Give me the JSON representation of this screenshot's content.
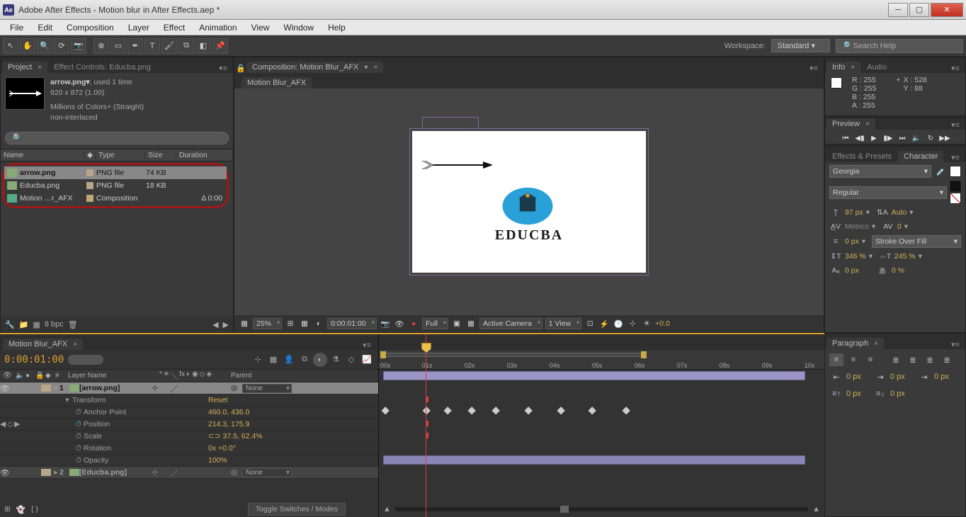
{
  "titlebar": {
    "icon_label": "Ae",
    "title": "Adobe After Effects - Motion blur in After Effects.aep *"
  },
  "menubar": [
    "File",
    "Edit",
    "Composition",
    "Layer",
    "Effect",
    "Animation",
    "View",
    "Window",
    "Help"
  ],
  "toolbar": {
    "workspace_label": "Workspace:",
    "workspace_value": "Standard",
    "search_placeholder": "Search Help"
  },
  "project": {
    "tab_project": "Project",
    "tab_effect_controls": "Effect Controls: Educba.png",
    "asset": {
      "name": "arrow.png▾",
      "usage": ", used 1 time",
      "dims": "920 x 872 (1.00)",
      "colors": "Millions of Colors+ (Straight)",
      "interlace": "non-interlaced"
    },
    "cols": {
      "name": "Name",
      "type": "Type",
      "size": "Size",
      "duration": "Duration"
    },
    "rows": [
      {
        "name": "arrow.png",
        "type": "PNG file",
        "size": "74 KB",
        "duration": ""
      },
      {
        "name": "Educba.png",
        "type": "PNG file",
        "size": "18 KB",
        "duration": ""
      },
      {
        "name": "Motion …r_AFX",
        "type": "Composition",
        "size": "",
        "duration": "Δ 0:00"
      }
    ],
    "bpc": "8 bpc"
  },
  "composition": {
    "tab_label": "Composition: Motion Blur_AFX",
    "inner_tab": "Motion Blur_AFX",
    "logo_text": "EDUCBA",
    "footer": {
      "zoom": "25%",
      "time": "0:00:01:00",
      "res": "Full",
      "camera": "Active Camera",
      "views": "1 View",
      "exposure": "+0.0"
    }
  },
  "info": {
    "tab_info": "Info",
    "tab_audio": "Audio",
    "r": "R : 255",
    "g": "G : 255",
    "b": "B : 255",
    "a": "A : 255",
    "x": "X : 528",
    "y": "Y : 88"
  },
  "preview": {
    "tab": "Preview"
  },
  "effects_presets": {
    "tab": "Effects & Presets"
  },
  "character": {
    "tab": "Character",
    "font": "Georgia",
    "style": "Regular",
    "size": "97 px",
    "leading": "Auto",
    "kerning": "Metrics",
    "tracking": "0",
    "stroke_w": "0 px",
    "stroke_mode": "Stroke Over Fill",
    "vscale": "346 %",
    "hscale": "245 %",
    "baseline": "0 px",
    "tsume": "0 %"
  },
  "paragraph": {
    "tab": "Paragraph",
    "indent_l": "0 px",
    "indent_r": "0 px",
    "indent_first": "0 px",
    "space_before": "0 px",
    "space_after": "0 px"
  },
  "timeline": {
    "tab": "Motion Blur_AFX",
    "timecode": "0:00:01:00",
    "cols": {
      "layer": "Layer Name",
      "parent": "Parent"
    },
    "layers": [
      {
        "num": "1",
        "name": "[arrow.png]",
        "parent": "None"
      },
      {
        "num": "2",
        "name": "[Educba.png]",
        "parent": "None"
      }
    ],
    "transform": "Transform",
    "reset": "Reset",
    "props": [
      {
        "name": "Anchor Point",
        "val": "460.0, 436.0",
        "kf": false
      },
      {
        "name": "Position",
        "val": "214.3, 175.9",
        "kf": true
      },
      {
        "name": "Scale",
        "val": "⊂⊃ 37.5, 62.4%",
        "kf": false
      },
      {
        "name": "Rotation",
        "val": "0x +0.0°",
        "kf": false
      },
      {
        "name": "Opacity",
        "val": "100%",
        "kf": false
      }
    ],
    "toggle_label": "Toggle Switches / Modes",
    "ticks": [
      ":00s",
      "01s",
      "02s",
      "03s",
      "04s",
      "05s",
      "06s",
      "07s",
      "08s",
      "09s",
      "10s"
    ]
  }
}
